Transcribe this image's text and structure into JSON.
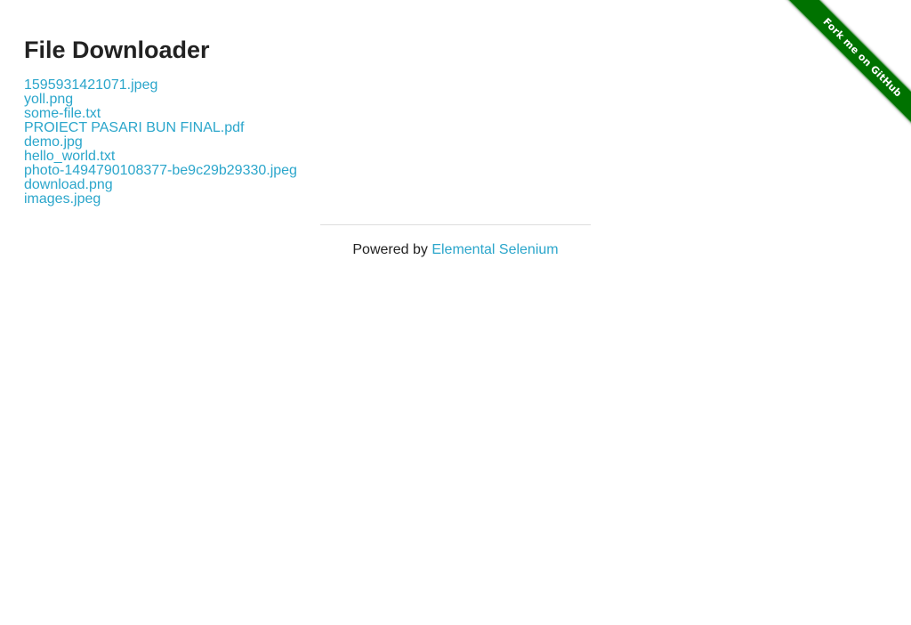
{
  "page": {
    "title": "File Downloader"
  },
  "files": [
    "1595931421071.jpeg",
    "yoll.png",
    "some-file.txt",
    "PROIECT PASARI BUN FINAL.pdf",
    "demo.jpg",
    "hello_world.txt",
    "photo-1494790108377-be9c29b29330.jpeg",
    "download.png",
    "images.jpeg"
  ],
  "footer": {
    "prefix": "Powered by",
    "link_text": "Elemental Selenium"
  },
  "ribbon": {
    "label": "Fork me on GitHub"
  },
  "colors": {
    "link": "#2ba6cb",
    "ribbon": "#007200",
    "text": "#222222"
  }
}
